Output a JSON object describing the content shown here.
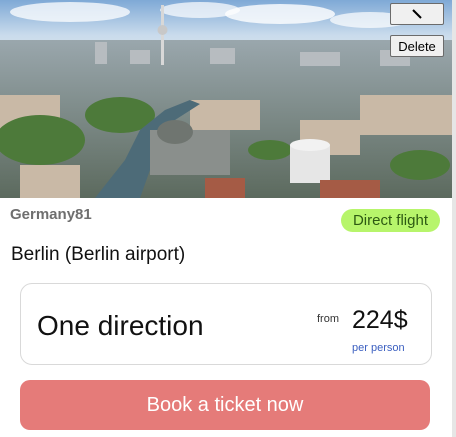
{
  "toolbar": {
    "edit_icon": "pencil-icon",
    "delete_label": "Delete"
  },
  "card": {
    "photo_alt_icon": "city-photo",
    "owner": "Germany81",
    "badge": "Direct flight",
    "city": "Berlin (Berlin airport)",
    "direction": "One direction",
    "from_label": "from",
    "price": "224$",
    "per_person": "per person",
    "book_label": "Book a ticket now"
  },
  "colors": {
    "badge_bg": "#b7f56b",
    "book_button": "#e57b79",
    "per_person_text": "#3b5fc0"
  }
}
